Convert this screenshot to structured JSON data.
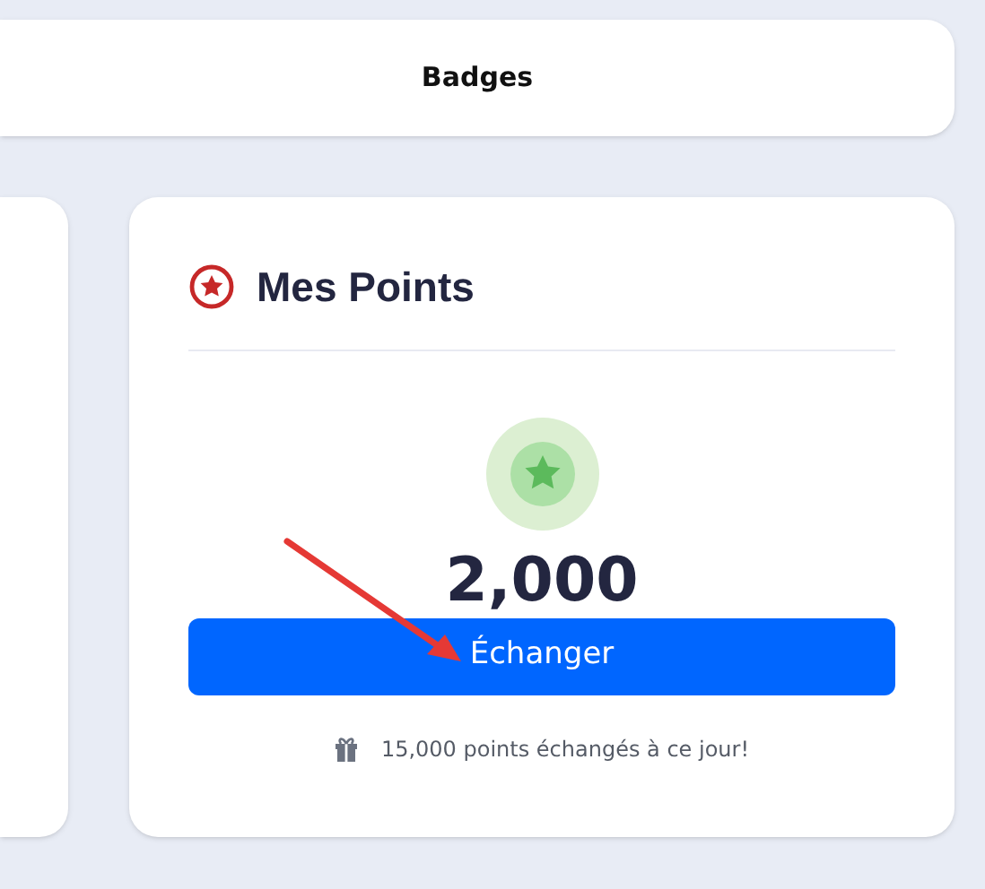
{
  "header": {
    "title": "Badges"
  },
  "points_card": {
    "title": "Mes Points",
    "points": "2,000",
    "button": "Échanger",
    "footer": "15,000 points échangés à ce jour!"
  }
}
